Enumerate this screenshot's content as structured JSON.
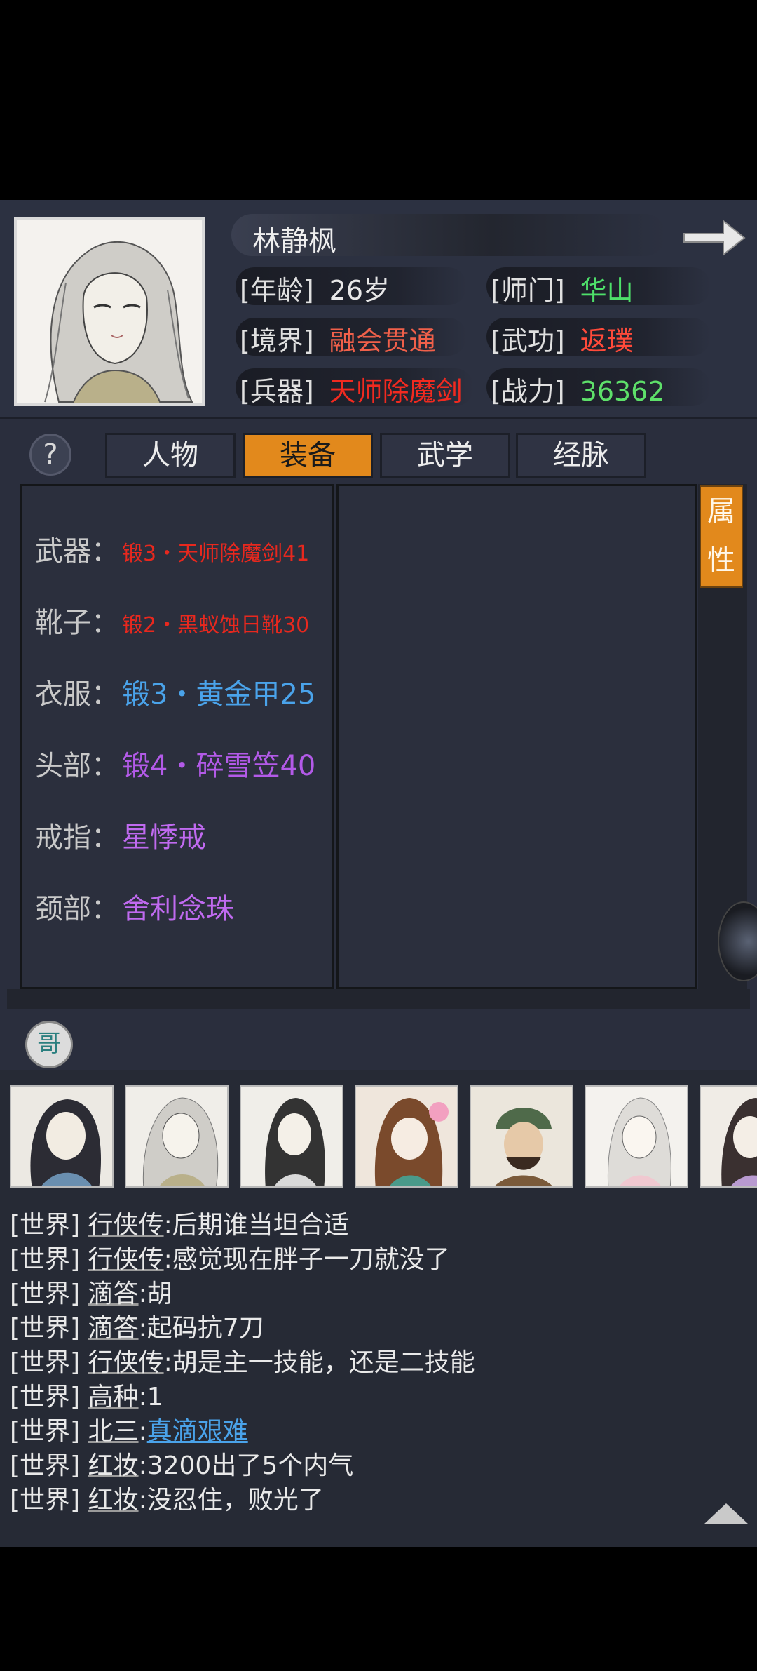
{
  "header": {
    "name": "林静枫",
    "stats": [
      {
        "label": "[年龄]",
        "value": "26岁",
        "color": "#e8e8e8"
      },
      {
        "label": "[师门]",
        "value": "华山",
        "color": "#4ee06a"
      },
      {
        "label": "[境界]",
        "value": "融会贯通",
        "color": "#f0604a"
      },
      {
        "label": "[武功]",
        "value": "返璞",
        "color": "#ff4a3a"
      },
      {
        "label": "[兵器]",
        "value": "天师除魔剑",
        "color": "#f12a20"
      },
      {
        "label": "[战力]",
        "value": "36362",
        "color": "#5ee06a"
      }
    ]
  },
  "tabs": [
    {
      "label": "人物",
      "active": false
    },
    {
      "label": "装备",
      "active": true
    },
    {
      "label": "武学",
      "active": false
    },
    {
      "label": "经脉",
      "active": false
    }
  ],
  "help_label": "?",
  "attr_button": {
    "line1": "属",
    "line2": "性"
  },
  "equipment": [
    {
      "slot": "武器：",
      "item": "锻3・天师除魔剑41",
      "color": "#e8281e",
      "size": "small"
    },
    {
      "slot": "靴子：",
      "item": "锻2・黑蚁蚀日靴30",
      "color": "#e8281e",
      "size": "small"
    },
    {
      "slot": "衣服：",
      "item": "锻3・黄金甲25",
      "color": "#4aa3ea",
      "size": "large"
    },
    {
      "slot": "头部：",
      "item": "锻4・碎雪笠40",
      "color": "#b35ae8",
      "size": "large"
    },
    {
      "slot": "戒指：",
      "item": "星悸戒",
      "color": "#c06af0",
      "size": "large"
    },
    {
      "slot": "颈部：",
      "item": "舍利念珠",
      "color": "#c06af0",
      "size": "large"
    }
  ],
  "orb_label": "哥",
  "chat": [
    {
      "channel": "[世界]",
      "user": "行侠传",
      "sep": ":",
      "msg": "后期谁当坦合适",
      "msg_color": "#e9e9e9"
    },
    {
      "channel": "[世界]",
      "user": "行侠传",
      "sep": ":",
      "msg": "感觉现在胖子一刀就没了",
      "msg_color": "#e9e9e9"
    },
    {
      "channel": "[世界]",
      "user": "滴答",
      "sep": ":",
      "msg": "胡",
      "msg_color": "#e9e9e9"
    },
    {
      "channel": "[世界]",
      "user": "滴答",
      "sep": ":",
      "msg": "起码抗7刀",
      "msg_color": "#e9e9e9"
    },
    {
      "channel": "[世界]",
      "user": "行侠传",
      "sep": ":",
      "msg": "胡是主一技能，还是二技能",
      "msg_color": "#e9e9e9"
    },
    {
      "channel": "[世界]",
      "user": "高种",
      "sep": ":",
      "msg": "1",
      "msg_color": "#e9e9e9"
    },
    {
      "channel": "[世界]",
      "user": "北三",
      "sep": ":",
      "msg": "真滴艰难",
      "msg_color": "#4aa3ea"
    },
    {
      "channel": "[世界]",
      "user": "红妆",
      "sep": ":",
      "msg": "3200出了5个内气",
      "msg_color": "#e9e9e9"
    },
    {
      "channel": "[世界]",
      "user": "红妆",
      "sep": ":",
      "msg": "没忍住，败光了",
      "msg_color": "#e9e9e9"
    }
  ]
}
